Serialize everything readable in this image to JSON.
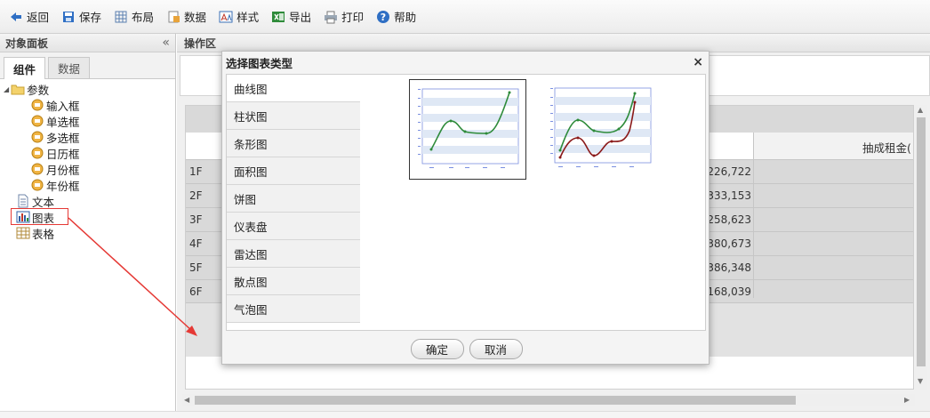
{
  "toolbar": {
    "items": [
      {
        "label": "返回",
        "icon": "back-arrow-icon"
      },
      {
        "label": "保存",
        "icon": "save-icon"
      },
      {
        "label": "布局",
        "icon": "layout-icon"
      },
      {
        "label": "数据",
        "icon": "data-icon"
      },
      {
        "label": "样式",
        "icon": "style-icon"
      },
      {
        "label": "导出",
        "icon": "export-icon"
      },
      {
        "label": "打印",
        "icon": "print-icon"
      },
      {
        "label": "帮助",
        "icon": "help-icon"
      }
    ]
  },
  "left_panel": {
    "title": "对象面板",
    "collapse": "«",
    "tabs": [
      "组件",
      "数据"
    ],
    "tree": {
      "root": "参数",
      "params": [
        "输入框",
        "单选框",
        "多选框",
        "日历框",
        "月份框",
        "年份框"
      ],
      "text": "文本",
      "chart": "图表",
      "table": "表格"
    }
  },
  "op_area": {
    "title": "操作区",
    "column_header_right": "抽成租金(",
    "rows": [
      {
        "label": "1F",
        "value": "226,722"
      },
      {
        "label": "2F",
        "value": "333,153"
      },
      {
        "label": "3F",
        "value": "258,623"
      },
      {
        "label": "4F",
        "value": "380,673"
      },
      {
        "label": "5F",
        "value": "386,348"
      },
      {
        "label": "6F",
        "value": "168,039"
      }
    ]
  },
  "dialog": {
    "title": "选择图表类型",
    "close": "×",
    "chart_types": [
      "曲线图",
      "柱状图",
      "条形图",
      "面积图",
      "饼图",
      "仪表盘",
      "雷达图",
      "散点图",
      "气泡图"
    ],
    "selected_type": "曲线图",
    "ok": "确定",
    "cancel": "取消"
  },
  "colors": {
    "highlight": "#e53935",
    "series_green": "#2e8b3a",
    "series_red": "#8b1a1a",
    "band_blue": "#dfe8f5"
  }
}
